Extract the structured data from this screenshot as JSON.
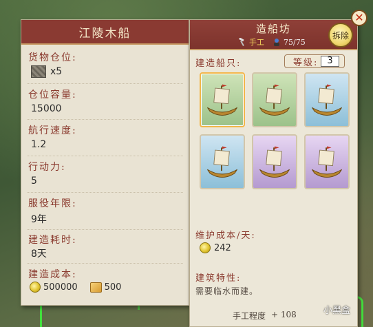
{
  "ship_panel": {
    "title": "江陵木船",
    "cargo_label": "货物仓位:",
    "cargo_value": "x5",
    "capacity_label": "仓位容量:",
    "capacity_value": "15000",
    "speed_label": "航行速度:",
    "speed_value": "1.2",
    "action_label": "行动力:",
    "action_value": "5",
    "service_label": "服役年限:",
    "service_value": "9年",
    "build_time_label": "建造耗时:",
    "build_time_value": "8天",
    "build_cost_label": "建造成本:",
    "cost_coins": "500000",
    "cost_wood": "500"
  },
  "shipyard": {
    "title": "造船坊",
    "type": "手工",
    "workers": "75/75",
    "demolish_label": "拆除",
    "close_label": "✕",
    "build_ships_label": "建造船只:",
    "level_label": "等级:",
    "level_value": "3",
    "ships": [
      {
        "rarity": "green",
        "selected": true
      },
      {
        "rarity": "green",
        "selected": false
      },
      {
        "rarity": "blue",
        "selected": false
      },
      {
        "rarity": "blue",
        "selected": false
      },
      {
        "rarity": "purple",
        "selected": false
      },
      {
        "rarity": "purple",
        "selected": false
      }
    ],
    "maintenance_label": "维护成本/天:",
    "maintenance_value": "242",
    "feature_label": "建筑特性:",
    "feature_text": "需要临水而建。",
    "craft_label": "手工程度",
    "craft_value": "+ 108"
  },
  "watermark": "小黑盒",
  "colors": {
    "header_red": "#8a3a32",
    "label_red": "#8a3a2e",
    "panel_bg": "#e9e3d3",
    "green_card": "#9cc28a",
    "blue_card": "#8cbfd8",
    "purple_card": "#b49ad0",
    "selected_border": "#f2b64a"
  },
  "icons": [
    "crate-icon",
    "coin-icon",
    "wood-icon",
    "hammer-icon",
    "worker-icon",
    "close-icon"
  ]
}
